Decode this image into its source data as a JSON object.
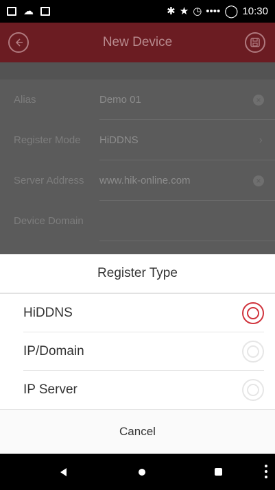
{
  "status_bar": {
    "time": "10:30",
    "icons": [
      "image-icon",
      "cloud-upload-icon",
      "photo-stack-icon",
      "bluetooth-icon",
      "star-icon",
      "alarm-icon",
      "signal-icon",
      "battery-ring-icon"
    ]
  },
  "header": {
    "title": "New Device",
    "back_icon": "back-arrow-icon",
    "save_icon": "save-icon",
    "accent_color": "#c8262f"
  },
  "form": {
    "rows": [
      {
        "label": "Alias",
        "value": "Demo 01",
        "accessory": "clear-icon"
      },
      {
        "label": "Register Mode",
        "value": "HiDDNS",
        "accessory": "chevron-right-icon"
      },
      {
        "label": "Server Address",
        "value": "www.hik-online.com",
        "accessory": "clear-icon"
      },
      {
        "label": "Device Domain",
        "value": "",
        "accessory": ""
      }
    ]
  },
  "sheet": {
    "title": "Register Type",
    "options": [
      {
        "label": "HiDDNS",
        "selected": true
      },
      {
        "label": "IP/Domain",
        "selected": false
      },
      {
        "label": "IP Server",
        "selected": false
      }
    ],
    "cancel_label": "Cancel",
    "selected_color": "#d0333c"
  }
}
